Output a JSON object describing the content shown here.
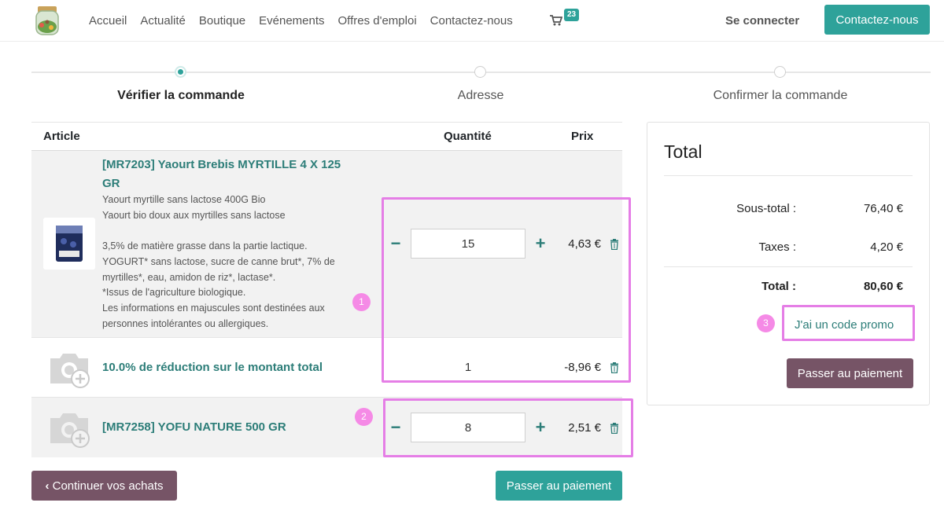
{
  "header": {
    "nav": [
      "Accueil",
      "Actualité",
      "Boutique",
      "Evénements",
      "Offres d'emploi",
      "Contactez-nous"
    ],
    "cart_count": "23",
    "login": "Se connecter",
    "contact_button": "Contactez-nous"
  },
  "wizard": {
    "steps": [
      "Vérifier la commande",
      "Adresse",
      "Confirmer la commande"
    ],
    "active_step": 0
  },
  "table": {
    "headers": {
      "article": "Article",
      "quantity": "Quantité",
      "price": "Prix"
    },
    "rows": [
      {
        "name_line1": "[MR7203] Yaourt Brebis MYRTILLE 4 X 125",
        "name_line2": "GR",
        "desc": [
          "Yaourt myrtille sans lactose 400G Bio",
          "Yaourt bio doux aux myrtilles sans lactose",
          "",
          "3,5% de matière grasse dans la partie lactique.",
          "YOGURT* sans lactose, sucre de canne brut*, 7% de",
          "myrtilles*, eau, amidon de riz*, lactase*.",
          "*Issus de l'agriculture biologique.",
          "Les informations en majuscules sont destinées aux",
          "personnes intolérantes ou allergiques."
        ],
        "quantity": "15",
        "price": "4,63 €"
      },
      {
        "name": "10.0% de réduction sur le montant total",
        "quantity": "1",
        "price": "-8,96 €"
      },
      {
        "name": "[MR7258] YOFU NATURE 500 GR",
        "quantity": "8",
        "price": "2,51 €"
      }
    ],
    "qty_minus": "−",
    "qty_plus": "+"
  },
  "actions": {
    "continue": "Continuer vos achats",
    "pay": "Passer au paiement"
  },
  "summary": {
    "title": "Total",
    "subtotal_label": "Sous-total :",
    "subtotal": "76,40 €",
    "taxes_label": "Taxes :",
    "taxes": "4,20 €",
    "total_label": "Total :",
    "total": "80,60 €",
    "promo": "J'ai un code promo",
    "pay": "Passer au paiement"
  },
  "annotations": {
    "m1": "1",
    "m2": "2",
    "m3": "3"
  },
  "colors": {
    "accent": "#2ea29a",
    "secondary": "#765466",
    "link": "#2c7d78",
    "annotation": "#e57ee6"
  }
}
